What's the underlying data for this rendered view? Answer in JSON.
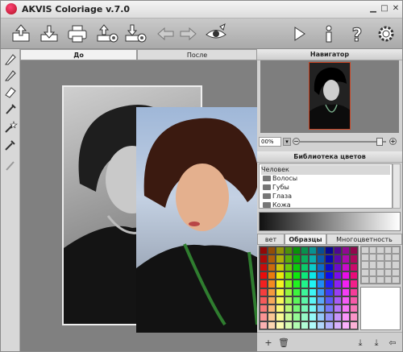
{
  "window": {
    "title": "AKVIS Coloriage v.7.0"
  },
  "toolbar": {
    "buttons": [
      {
        "name": "open-icon"
      },
      {
        "name": "save-icon"
      },
      {
        "name": "print-icon"
      },
      {
        "name": "export-settings-icon"
      },
      {
        "name": "import-settings-icon"
      },
      {
        "name": "undo-icon"
      },
      {
        "name": "redo-icon"
      },
      {
        "name": "eye-preview-icon"
      },
      {
        "name": "run-icon"
      },
      {
        "name": "info-icon"
      },
      {
        "name": "help-icon"
      },
      {
        "name": "settings-icon"
      }
    ]
  },
  "canvas_tabs": {
    "before": "До",
    "after": "После"
  },
  "navigator": {
    "title": "Навигатор",
    "zoom": "00%"
  },
  "color_library": {
    "title": "Библиотека цветов",
    "root": "Человек",
    "items": [
      "Волосы",
      "Губы",
      "Глаза",
      "Кожа"
    ]
  },
  "palette_tabs": {
    "tab1": "вет",
    "tab2": "Образцы",
    "tab3": "Многоцветность"
  },
  "colors": {
    "accent": "#c42020",
    "panel": "#d2d2d2",
    "canvas": "#808080"
  }
}
